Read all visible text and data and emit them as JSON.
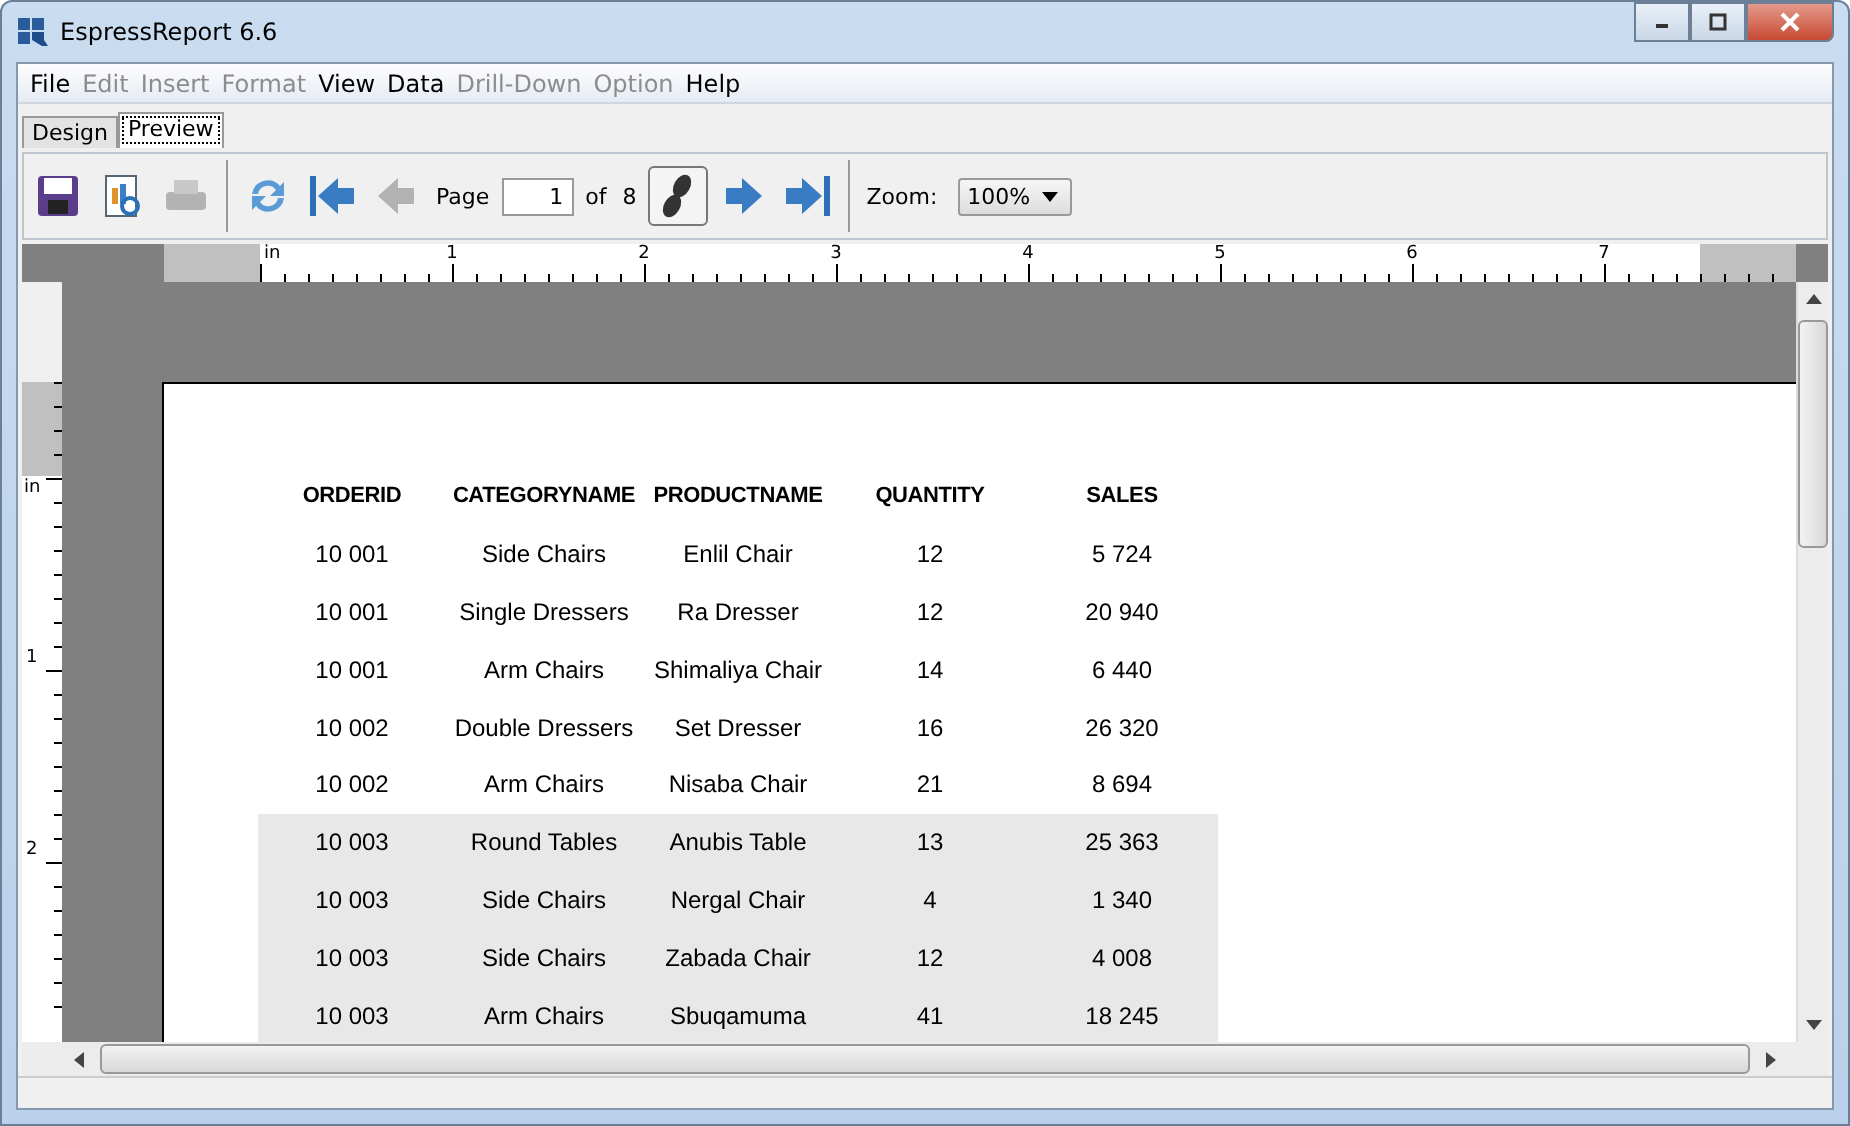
{
  "window": {
    "title": "EspressReport 6.6"
  },
  "menu": [
    {
      "label": "File",
      "disabled": false
    },
    {
      "label": "Edit",
      "disabled": true
    },
    {
      "label": "Insert",
      "disabled": true
    },
    {
      "label": "Format",
      "disabled": true
    },
    {
      "label": "View",
      "disabled": false
    },
    {
      "label": "Data",
      "disabled": false
    },
    {
      "label": "Drill-Down",
      "disabled": true
    },
    {
      "label": "Option",
      "disabled": true
    },
    {
      "label": "Help",
      "disabled": false
    }
  ],
  "tabs": [
    {
      "label": "Design",
      "selected": false
    },
    {
      "label": "Preview",
      "selected": true
    }
  ],
  "toolbar": {
    "left": [
      {
        "kind": "save",
        "disabled": false
      },
      {
        "kind": "export",
        "disabled": false
      },
      {
        "kind": "print",
        "disabled": true
      }
    ],
    "nav_first": [
      {
        "kind": "refresh",
        "disabled": false
      },
      {
        "kind": "first",
        "disabled": false
      },
      {
        "kind": "prev",
        "disabled": true
      }
    ],
    "page_label": "Page",
    "page_value": "1",
    "of_label": "of",
    "page_count": "8",
    "nav_last": [
      {
        "kind": "go",
        "disabled": false
      },
      {
        "kind": "next",
        "disabled": false
      },
      {
        "kind": "last",
        "disabled": false
      }
    ],
    "zoom_label": "Zoom:",
    "zoom_value": "100%"
  },
  "ruler": {
    "h_unit": "in",
    "h_marks": [
      "1",
      "2",
      "3",
      "4",
      "5",
      "6",
      "7"
    ],
    "v_unit": "in",
    "v_marks": [
      "1",
      "2"
    ]
  },
  "report": {
    "columns": [
      "ORDERID",
      "CATEGORYNAME",
      "PRODUCTNAME",
      "QUANTITY",
      "SALES"
    ],
    "rows": [
      {
        "cells": [
          "10 001",
          "Side Chairs",
          "Enlil Chair",
          "12",
          "5 724"
        ],
        "shaded": false
      },
      {
        "cells": [
          "10 001",
          "Single Dressers",
          "Ra Dresser",
          "12",
          "20 940"
        ],
        "shaded": false
      },
      {
        "cells": [
          "10 001",
          "Arm Chairs",
          "Shimaliya Chair",
          "14",
          "6 440"
        ],
        "shaded": false
      },
      {
        "cells": [
          "10 002",
          "Double Dressers",
          "Set Dresser",
          "16",
          "26 320"
        ],
        "shaded": false
      },
      {
        "cells": [
          "10 002",
          "Arm Chairs",
          "Nisaba Chair",
          "21",
          "8 694"
        ],
        "shaded": false
      },
      {
        "cells": [
          "10 003",
          "Round Tables",
          "Anubis Table",
          "13",
          "25 363"
        ],
        "shaded": true
      },
      {
        "cells": [
          "10 003",
          "Side Chairs",
          "Nergal Chair",
          "4",
          "1 340"
        ],
        "shaded": true
      },
      {
        "cells": [
          "10 003",
          "Side Chairs",
          "Zabada Chair",
          "12",
          "4 008"
        ],
        "shaded": true
      },
      {
        "cells": [
          "10 003",
          "Arm Chairs",
          "Sbuqamuma",
          "41",
          "18 245"
        ],
        "shaded": true
      }
    ]
  }
}
